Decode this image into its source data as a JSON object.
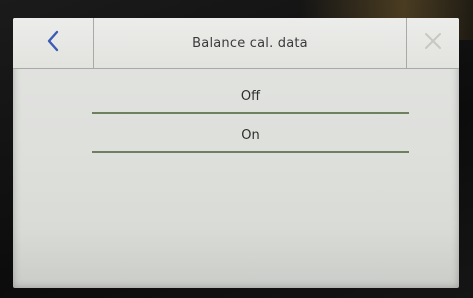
{
  "title_bar": {
    "title": "Balance cal. data",
    "back_icon": "chevron-left-icon",
    "close_icon": "close-icon",
    "back_color": "#3b5bb5",
    "close_color": "#c6c8c4"
  },
  "options": [
    {
      "label": "Off"
    },
    {
      "label": "On"
    }
  ]
}
